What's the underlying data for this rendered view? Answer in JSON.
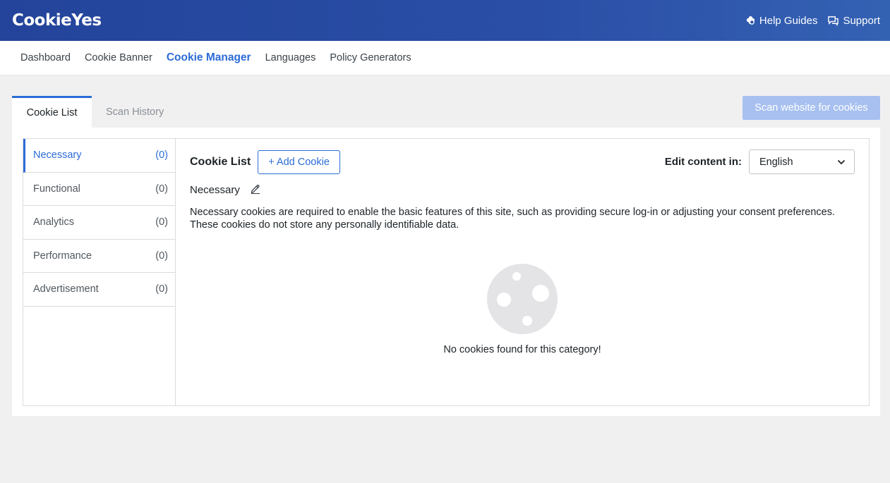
{
  "brand": {
    "logo": "CookieYes"
  },
  "topbar": {
    "help_label": "Help Guides",
    "support_label": "Support"
  },
  "nav": [
    "Dashboard",
    "Cookie Banner",
    "Cookie Manager",
    "Languages",
    "Policy Generators"
  ],
  "tabs": [
    "Cookie List",
    "Scan History"
  ],
  "scan_button": "Scan website for cookies",
  "categories": [
    {
      "name": "Necessary",
      "count": "(0)"
    },
    {
      "name": "Functional",
      "count": "(0)"
    },
    {
      "name": "Analytics",
      "count": "(0)"
    },
    {
      "name": "Performance",
      "count": "(0)"
    },
    {
      "name": "Advertisement",
      "count": "(0)"
    }
  ],
  "main": {
    "title": "Cookie List",
    "add_button": "+ Add Cookie",
    "edit_label": "Edit content in:",
    "language": "English",
    "category_title": "Necessary",
    "description": "Necessary cookies are required to enable the basic features of this site, such as providing secure log-in or adjusting your consent preferences. These cookies do not store any personally identifiable data.",
    "empty_text": "No cookies found for this category!"
  },
  "colors": {
    "accent": "#2c6cd6",
    "header": "#2a4ea6",
    "scan_button": "#a7c0f0"
  }
}
